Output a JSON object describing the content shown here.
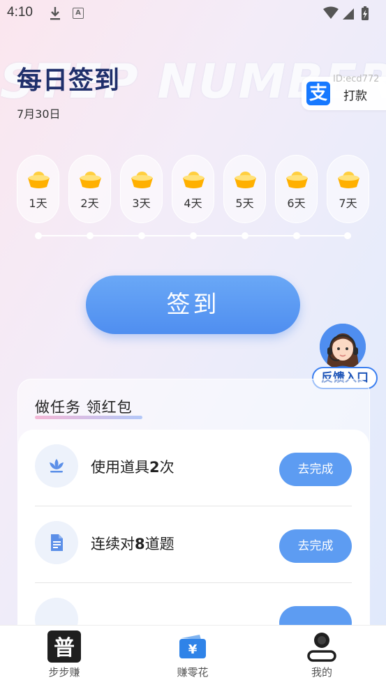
{
  "status_bar": {
    "time": "4:10",
    "ai_badge": "A"
  },
  "watermark": "STEP NUMBER",
  "header": {
    "title": "每日签到",
    "date": "7月30日"
  },
  "pay_chip": {
    "id_text": "ID:ecd772",
    "label": "打款",
    "logo_glyph": "支"
  },
  "days": [
    {
      "label": "1天"
    },
    {
      "label": "2天"
    },
    {
      "label": "3天"
    },
    {
      "label": "4天"
    },
    {
      "label": "5天"
    },
    {
      "label": "6天"
    },
    {
      "label": "7天"
    }
  ],
  "sign_button": "签到",
  "feedback": {
    "label": "反馈入口"
  },
  "tasks": {
    "heading": "做任务 领红包",
    "items": [
      {
        "text_pre": "使用道具",
        "text_num": "2",
        "text_post": "次",
        "button": "去完成",
        "icon": "lotus-icon"
      },
      {
        "text_pre": "连续对",
        "text_num": "8",
        "text_post": "道题",
        "button": "去完成",
        "icon": "document-icon"
      }
    ]
  },
  "tabbar": {
    "tabs": [
      {
        "label": "步步赚",
        "icon_glyph": "普"
      },
      {
        "label": "赚零花",
        "icon_glyph": "¥"
      },
      {
        "label": "我的"
      }
    ]
  },
  "colors": {
    "accent": "#5d9cf2",
    "title": "#1f2f6b",
    "alipay": "#1678ff"
  }
}
